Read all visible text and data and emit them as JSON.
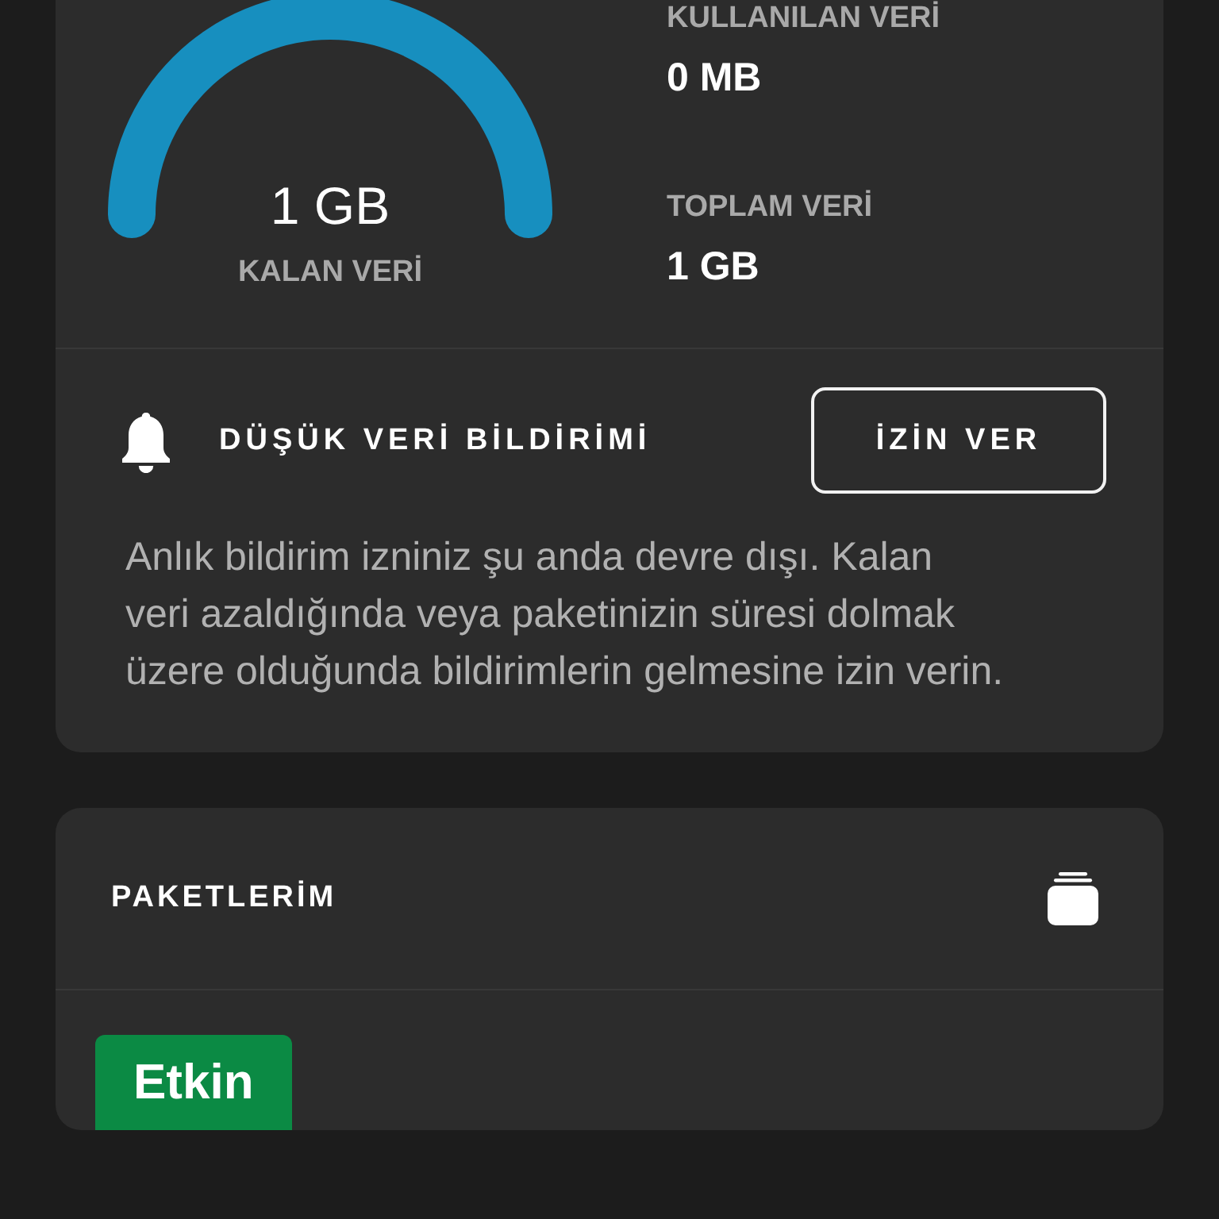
{
  "usage": {
    "gauge": {
      "level": 1,
      "value": "1 GB",
      "label": "KALAN VERİ"
    },
    "stats": [
      {
        "label": "KULLANILAN VERİ",
        "value": "0 MB"
      },
      {
        "label": "TOPLAM VERİ",
        "value": "1 GB"
      }
    ]
  },
  "low_data_notification": {
    "title": "DÜŞÜK VERİ BİLDİRİMİ",
    "button": "İZİN VER",
    "description": "Anlık bildirim izniniz şu anda devre dışı. Kalan veri azaldığında veya paketinizin süresi dolmak üzere olduğunda bildirimlerin gelmesine izin verin."
  },
  "packages": {
    "title": "PAKETLERİM",
    "items": [
      {
        "status": "Etkin"
      }
    ]
  }
}
